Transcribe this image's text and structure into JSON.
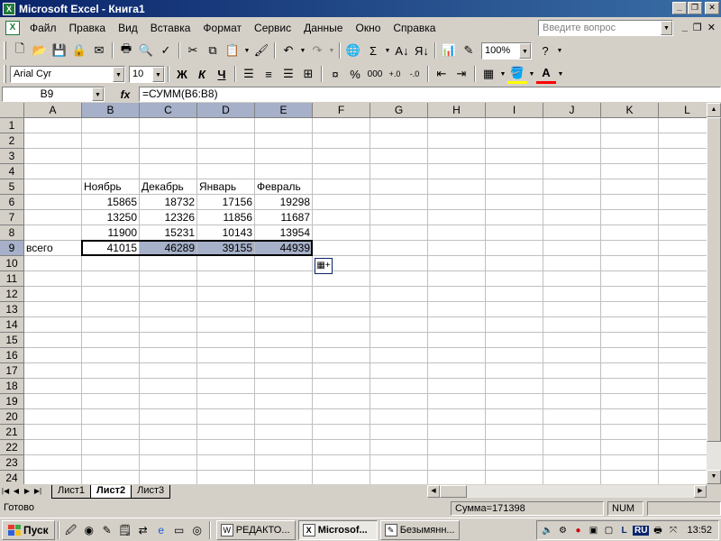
{
  "window": {
    "title": "Microsoft Excel - Книга1"
  },
  "menu": {
    "items": [
      "Файл",
      "Правка",
      "Вид",
      "Вставка",
      "Формат",
      "Сервис",
      "Данные",
      "Окно",
      "Справка"
    ],
    "ask_placeholder": "Введите вопрос"
  },
  "toolbar": {
    "zoom": "100%",
    "font_name": "Arial Cyr",
    "font_size": "10",
    "bold_label": "Ж",
    "italic_label": "К",
    "underline_label": "Ч",
    "percent_label": "%",
    "thousands_label": "000",
    "sigma_label": "Σ"
  },
  "formula_bar": {
    "name_box": "B9",
    "fx_label": "fx",
    "formula": "=СУММ(B6:B8)"
  },
  "grid": {
    "columns": [
      "A",
      "B",
      "C",
      "D",
      "E",
      "F",
      "G",
      "H",
      "I",
      "J",
      "K",
      "L"
    ],
    "selected_columns": [
      "B",
      "C",
      "D",
      "E"
    ],
    "row_count": 24,
    "selected_row": 9,
    "cells": [
      {
        "row": 5,
        "col": "B",
        "value": "Ноябрь",
        "num": false
      },
      {
        "row": 5,
        "col": "C",
        "value": "Декабрь",
        "num": false
      },
      {
        "row": 5,
        "col": "D",
        "value": "Январь",
        "num": false
      },
      {
        "row": 5,
        "col": "E",
        "value": "Февраль",
        "num": false
      },
      {
        "row": 6,
        "col": "B",
        "value": "15865",
        "num": true
      },
      {
        "row": 6,
        "col": "C",
        "value": "18732",
        "num": true
      },
      {
        "row": 6,
        "col": "D",
        "value": "17156",
        "num": true
      },
      {
        "row": 6,
        "col": "E",
        "value": "19298",
        "num": true
      },
      {
        "row": 7,
        "col": "B",
        "value": "13250",
        "num": true
      },
      {
        "row": 7,
        "col": "C",
        "value": "12326",
        "num": true
      },
      {
        "row": 7,
        "col": "D",
        "value": "11856",
        "num": true
      },
      {
        "row": 7,
        "col": "E",
        "value": "11687",
        "num": true
      },
      {
        "row": 8,
        "col": "B",
        "value": "11900",
        "num": true
      },
      {
        "row": 8,
        "col": "C",
        "value": "15231",
        "num": true
      },
      {
        "row": 8,
        "col": "D",
        "value": "10143",
        "num": true
      },
      {
        "row": 8,
        "col": "E",
        "value": "13954",
        "num": true
      },
      {
        "row": 9,
        "col": "A",
        "value": "всего",
        "num": false
      },
      {
        "row": 9,
        "col": "B",
        "value": "41015",
        "num": true
      },
      {
        "row": 9,
        "col": "C",
        "value": "46289",
        "num": true
      },
      {
        "row": 9,
        "col": "D",
        "value": "39155",
        "num": true
      },
      {
        "row": 9,
        "col": "E",
        "value": "44939",
        "num": true
      }
    ],
    "highlighted_range": {
      "row": 9,
      "cols": [
        "C",
        "D",
        "E"
      ]
    }
  },
  "sheets": {
    "tabs": [
      "Лист1",
      "Лист2",
      "Лист3"
    ],
    "active": "Лист2"
  },
  "status": {
    "ready": "Готово",
    "sum": "Сумма=171398",
    "num": "NUM"
  },
  "taskbar": {
    "start_label": "Пуск",
    "tasks": [
      {
        "label": "РЕДАКТО...",
        "active": false
      },
      {
        "label": "Microsof...",
        "active": true
      },
      {
        "label": "Безымянн...",
        "active": false
      }
    ],
    "lang": "RU",
    "clock": "13:52"
  },
  "colors": {
    "title_bar": "#0a246a",
    "selection_fill": "#a6b0c8",
    "chrome": "#d4d0c8"
  }
}
